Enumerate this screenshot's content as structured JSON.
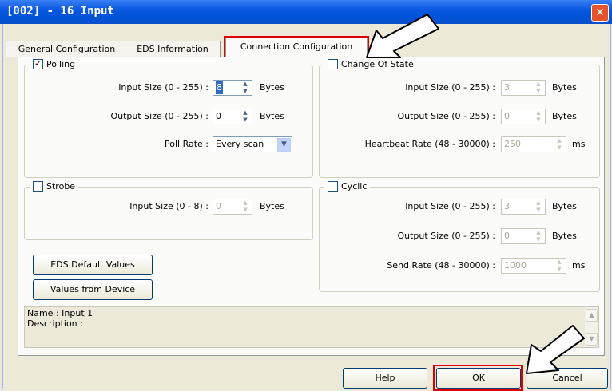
{
  "window": {
    "title": "[002] - 16 Input",
    "close_glyph": "✕"
  },
  "tabs": [
    {
      "label": "General Configuration"
    },
    {
      "label": "EDS Information"
    },
    {
      "label": "Connection Configuration"
    }
  ],
  "polling": {
    "label": "Polling",
    "checked": true,
    "input_size_label": "Input Size (0 - 255) :",
    "input_size_value": "8",
    "output_size_label": "Output Size (0 - 255) :",
    "output_size_value": "0",
    "bytes": "Bytes",
    "poll_rate_label": "Poll Rate :",
    "poll_rate_value": "Every scan"
  },
  "change_of_state": {
    "label": "Change Of State",
    "checked": false,
    "input_size_label": "Input Size (0 - 255) :",
    "input_size_value": "3",
    "output_size_label": "Output Size (0 - 255) :",
    "output_size_value": "0",
    "bytes": "Bytes",
    "heartbeat_label": "Heartbeat Rate (48 - 30000) :",
    "heartbeat_value": "250",
    "ms": "ms"
  },
  "strobe": {
    "label": "Strobe",
    "checked": false,
    "input_size_label": "Input Size (0 - 8) :",
    "input_size_value": "0",
    "bytes": "Bytes"
  },
  "cyclic": {
    "label": "Cyclic",
    "checked": false,
    "input_size_label": "Input Size (0 - 255) :",
    "input_size_value": "3",
    "output_size_label": "Output Size (0 - 255) :",
    "output_size_value": "0",
    "bytes": "Bytes",
    "send_rate_label": "Send Rate (48 - 30000) :",
    "send_rate_value": "1000",
    "ms": "ms"
  },
  "buttons": {
    "eds_default": "EDS Default Values",
    "values_from_device": "Values from Device",
    "help": "Help",
    "ok": "OK",
    "cancel": "Cancel"
  },
  "description_box": {
    "name_line": "Name : Input 1",
    "description_line": "Description :"
  },
  "colors": {
    "highlight": "#e00000",
    "titlebar": "#0053d8"
  }
}
